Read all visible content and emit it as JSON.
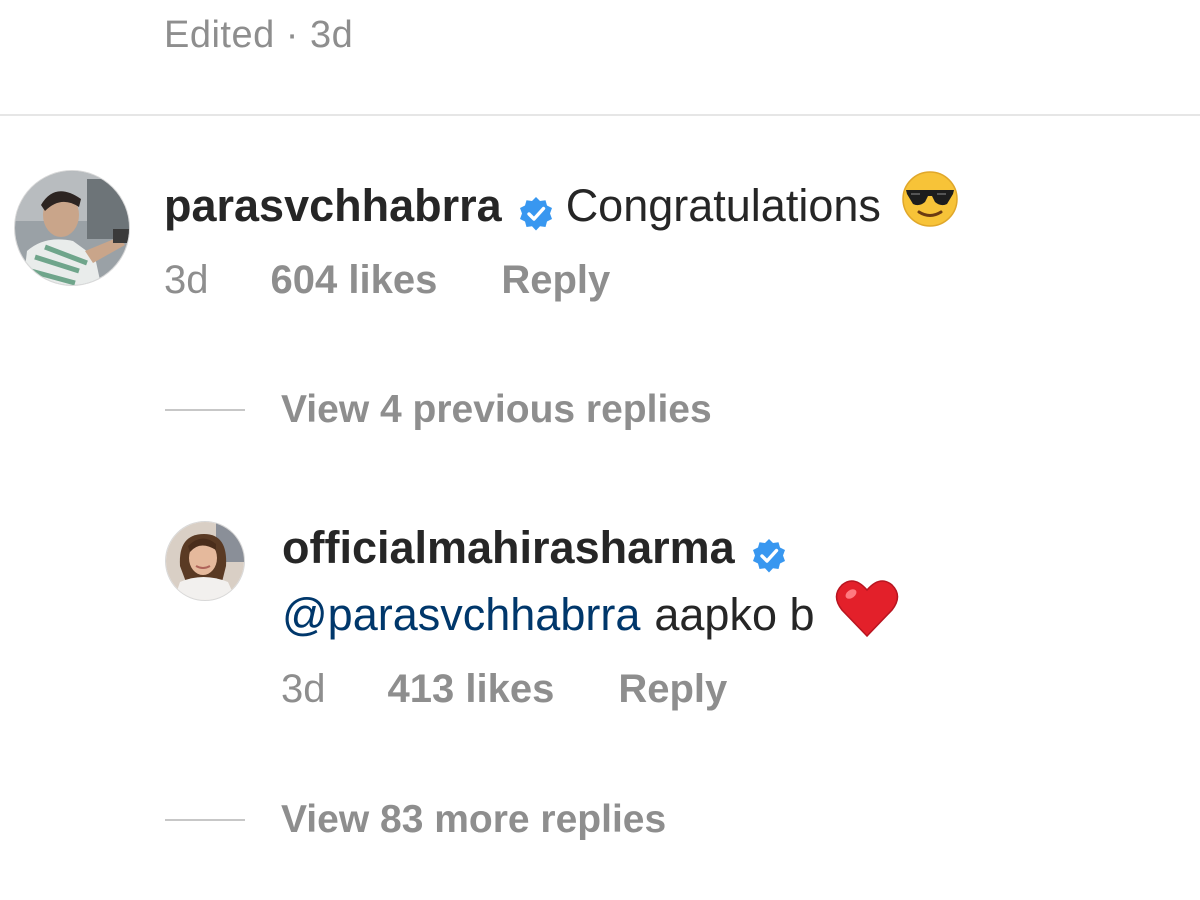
{
  "header": {
    "edited_label": "Edited · 3d"
  },
  "comments": [
    {
      "username": "parasvchhabrra",
      "verified": true,
      "text": "Congratulations",
      "emoji": "smiling-face-with-sunglasses",
      "time": "3d",
      "likes": "604 likes",
      "reply_label": "Reply"
    },
    {
      "username": "officialmahirasharma",
      "verified": true,
      "mention": "@parasvchhabrra",
      "text": "aapko b",
      "emoji": "red-heart",
      "time": "3d",
      "likes": "413 likes",
      "reply_label": "Reply"
    }
  ],
  "view_previous_replies": "View 4 previous replies",
  "view_more_replies": "View 83 more replies",
  "colors": {
    "text_primary": "#262626",
    "text_secondary": "#8e8e8e",
    "mention": "#00376b",
    "verified_badge": "#3897f0",
    "divider": "#e6e6e6"
  }
}
